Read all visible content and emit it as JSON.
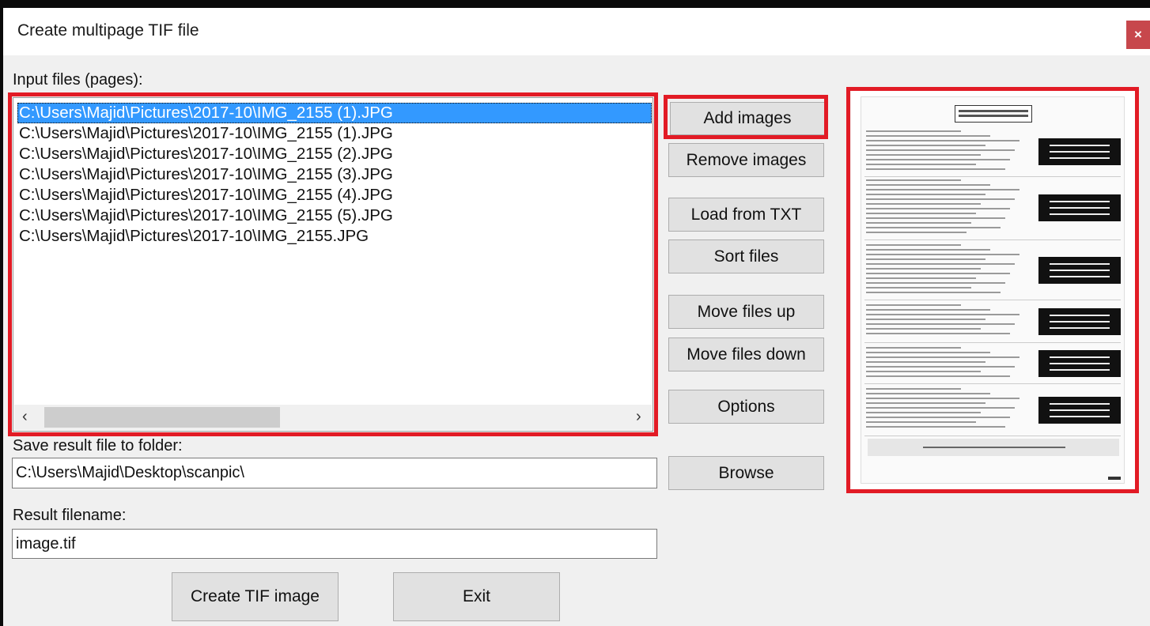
{
  "window": {
    "title": "Create multipage TIF file",
    "close_glyph": "×"
  },
  "input_section": {
    "label": "Input files (pages):"
  },
  "files": [
    "C:\\Users\\Majid\\Pictures\\2017-10\\IMG_2155 (1).JPG",
    "C:\\Users\\Majid\\Pictures\\2017-10\\IMG_2155 (1).JPG",
    "C:\\Users\\Majid\\Pictures\\2017-10\\IMG_2155 (2).JPG",
    "C:\\Users\\Majid\\Pictures\\2017-10\\IMG_2155 (3).JPG",
    "C:\\Users\\Majid\\Pictures\\2017-10\\IMG_2155 (4).JPG",
    "C:\\Users\\Majid\\Pictures\\2017-10\\IMG_2155 (5).JPG",
    "C:\\Users\\Majid\\Pictures\\2017-10\\IMG_2155.JPG"
  ],
  "selected_index": 0,
  "scrollbar": {
    "left_glyph": "‹",
    "right_glyph": "›"
  },
  "buttons": {
    "add_images": "Add images",
    "remove_images": "Remove images",
    "load_txt": "Load from TXT",
    "sort_files": "Sort files",
    "move_up": "Move files up",
    "move_down": "Move files down",
    "options": "Options",
    "browse": "Browse",
    "create": "Create TIF image",
    "exit": "Exit"
  },
  "save_folder": {
    "label": "Save result file to folder:",
    "value": "C:\\Users\\Majid\\Desktop\\scanpic\\"
  },
  "result_filename": {
    "label": "Result filename:",
    "value": "image.tif"
  },
  "colors": {
    "highlight": "#e21b25",
    "selection": "#3399ff",
    "close": "#c7474c"
  }
}
